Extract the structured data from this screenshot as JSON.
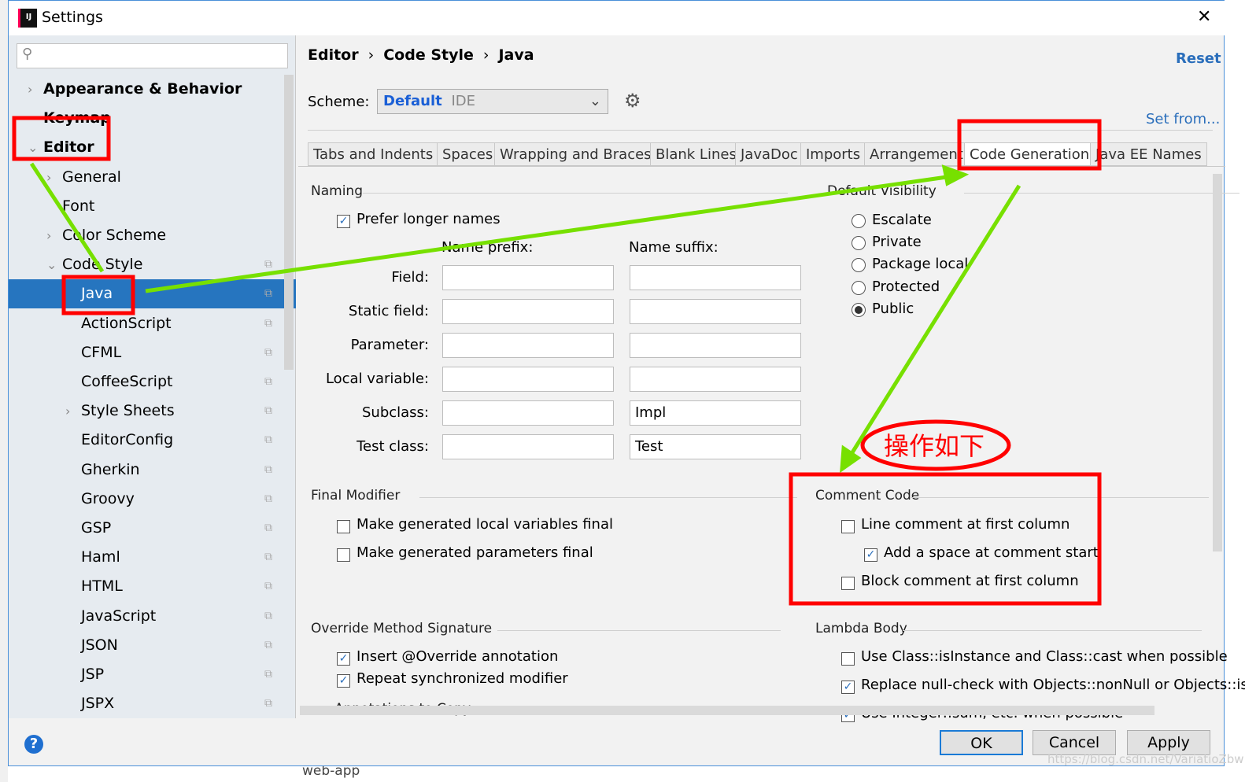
{
  "window": {
    "title": "Settings",
    "close": "✕"
  },
  "sidebar": {
    "search_placeholder": "",
    "items": [
      {
        "label": "Appearance & Behavior",
        "level": 0,
        "chevron": "›",
        "bold": true
      },
      {
        "label": "Keymap",
        "level": 0,
        "bold": true
      },
      {
        "label": "Editor",
        "level": 0,
        "chevron": "⌄",
        "bold": true
      },
      {
        "label": "General",
        "level": 1,
        "chevron": "›"
      },
      {
        "label": "Font",
        "level": 1
      },
      {
        "label": "Color Scheme",
        "level": 1,
        "chevron": "›"
      },
      {
        "label": "Code Style",
        "level": 1,
        "chevron": "⌄",
        "copy": true
      },
      {
        "label": "Java",
        "level": 2,
        "selected": true,
        "copy": true
      },
      {
        "label": "ActionScript",
        "level": 2,
        "copy": true
      },
      {
        "label": "CFML",
        "level": 2,
        "copy": true
      },
      {
        "label": "CoffeeScript",
        "level": 2,
        "copy": true
      },
      {
        "label": "Style Sheets",
        "level": 2,
        "chevron": "›",
        "copy": true
      },
      {
        "label": "EditorConfig",
        "level": 2,
        "copy": true
      },
      {
        "label": "Gherkin",
        "level": 2,
        "copy": true
      },
      {
        "label": "Groovy",
        "level": 2,
        "copy": true
      },
      {
        "label": "GSP",
        "level": 2,
        "copy": true
      },
      {
        "label": "Haml",
        "level": 2,
        "copy": true
      },
      {
        "label": "HTML",
        "level": 2,
        "copy": true
      },
      {
        "label": "JavaScript",
        "level": 2,
        "copy": true
      },
      {
        "label": "JSON",
        "level": 2,
        "copy": true
      },
      {
        "label": "JSP",
        "level": 2,
        "copy": true
      },
      {
        "label": "JSPX",
        "level": 2,
        "copy": true
      }
    ]
  },
  "breadcrumb": [
    "Editor",
    "Code Style",
    "Java"
  ],
  "reset": "Reset",
  "scheme": {
    "label": "Scheme:",
    "value": "Default",
    "suffix": "IDE"
  },
  "set_from": "Set from...",
  "tabs": [
    "Tabs and Indents",
    "Spaces",
    "Wrapping and Braces",
    "Blank Lines",
    "JavaDoc",
    "Imports",
    "Arrangement",
    "Code Generation",
    "Java EE Names"
  ],
  "active_tab": "Code Generation",
  "naming": {
    "title": "Naming",
    "prefer_longer": "Prefer longer names",
    "prefix_header": "Name prefix:",
    "suffix_header": "Name suffix:",
    "rows": [
      {
        "label": "Field:",
        "prefix": "",
        "suffix": ""
      },
      {
        "label": "Static field:",
        "prefix": "",
        "suffix": ""
      },
      {
        "label": "Parameter:",
        "prefix": "",
        "suffix": ""
      },
      {
        "label": "Local variable:",
        "prefix": "",
        "suffix": ""
      },
      {
        "label": "Subclass:",
        "prefix": "",
        "suffix": "Impl"
      },
      {
        "label": "Test class:",
        "prefix": "",
        "suffix": "Test"
      }
    ]
  },
  "visibility": {
    "title": "Default Visibility",
    "options": [
      "Escalate",
      "Private",
      "Package local",
      "Protected",
      "Public"
    ],
    "selected": "Public"
  },
  "final_modifier": {
    "title": "Final Modifier",
    "items": [
      {
        "label": "Make generated local variables final",
        "checked": false
      },
      {
        "label": "Make generated parameters final",
        "checked": false
      }
    ]
  },
  "comment_code": {
    "title": "Comment Code",
    "items": [
      {
        "label": "Line comment at first column",
        "checked": false
      },
      {
        "label": "Add a space at comment start",
        "checked": true
      },
      {
        "label": "Block comment at first column",
        "checked": false
      }
    ]
  },
  "override": {
    "title": "Override Method Signature",
    "items": [
      {
        "label": "Insert @Override annotation",
        "checked": true
      },
      {
        "label": "Repeat synchronized modifier",
        "checked": true
      }
    ],
    "annotations": "Annotations to Copy"
  },
  "lambda": {
    "title": "Lambda Body",
    "items": [
      {
        "label": "Use Class::isInstance and Class::cast when possible",
        "checked": false
      },
      {
        "label": "Replace null-check with Objects::nonNull or Objects::is",
        "checked": true
      },
      {
        "label": "Use Integer::sum, etc. when possible",
        "checked": true
      }
    ]
  },
  "buttons": {
    "ok": "OK",
    "cancel": "Cancel",
    "apply": "Apply",
    "help": "?"
  },
  "annotation_text": "操作如下",
  "watermark": "https://blog.csdn.net/VariatioZbw",
  "background_text": "web-app",
  "colors": {
    "accent": "#2675bf",
    "link": "#2a6ebb",
    "annotation_red": "#ff0000",
    "arrow_green": "#77e000"
  }
}
